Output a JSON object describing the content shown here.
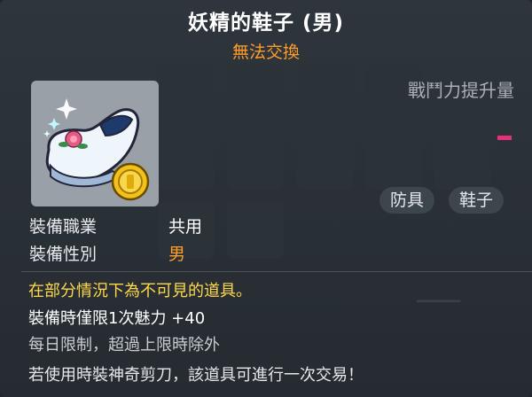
{
  "item": {
    "name": "妖精的鞋子 (男)",
    "trade_status": "無法交換",
    "icon": "fairy-shoe-icon"
  },
  "combat_power": {
    "label": "戰鬥力提升量",
    "indicator": "-"
  },
  "tags": [
    "防具",
    "鞋子"
  ],
  "requirements": {
    "job_label": "裝備職業",
    "job_value": "共用",
    "gender_label": "裝備性別",
    "gender_value": "男"
  },
  "description": {
    "visibility_note": "在部分情況下為不可見的道具。",
    "set_stat": "裝備時僅限1次魅力 +40",
    "daily_limit": "每日限制，超過上限時除外",
    "scissors_note": "若使用時裝神奇剪刀，該道具可進行一次交易！"
  },
  "colors": {
    "background": "#2b3238",
    "title": "#ffffff",
    "untradeable": "#ff9c2a",
    "warning_text": "#ffd94a",
    "combat_indicator": "#e8307d"
  }
}
